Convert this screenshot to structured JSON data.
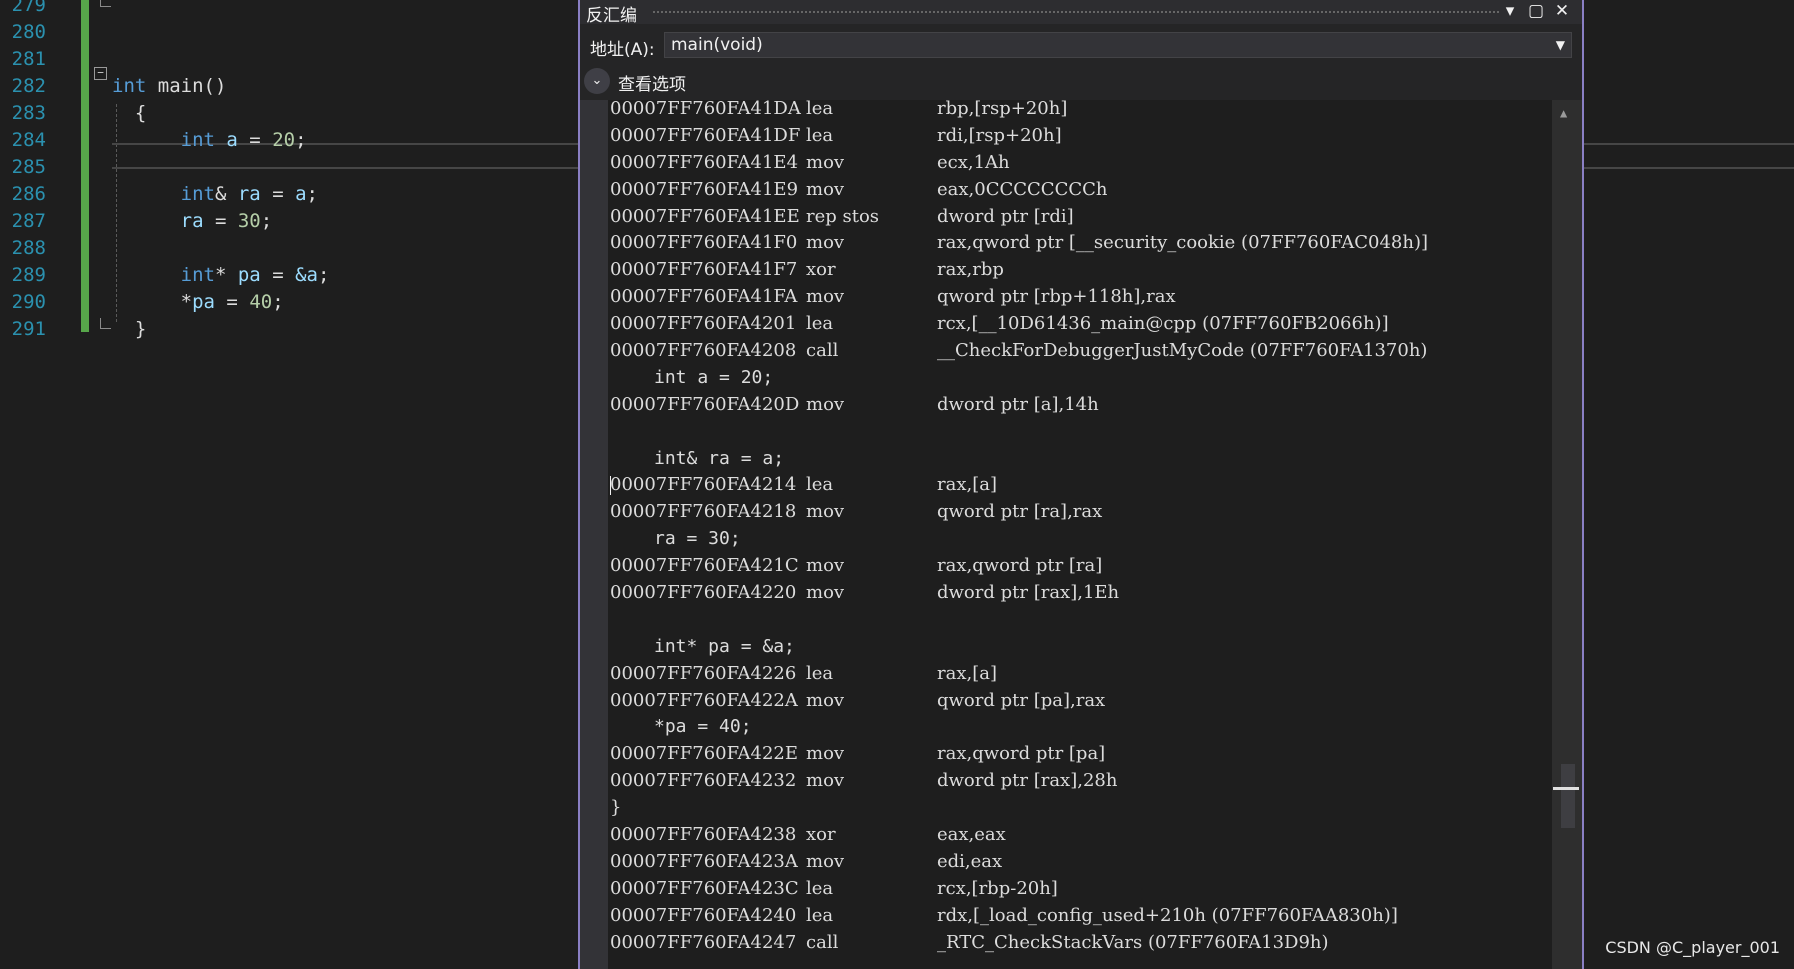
{
  "editor": {
    "line_numbers": [
      "279",
      "280",
      "281",
      "282",
      "283",
      "284",
      "285",
      "286",
      "287",
      "288",
      "289",
      "290",
      "291"
    ],
    "code": {
      "l282_kw": "int",
      "l282_rest": " main()",
      "l283": "{",
      "l284_kw": "int",
      "l284_var": " a",
      "l284_eq": " = ",
      "l284_num": "20",
      "l284_end": ";",
      "l286_kw": "int",
      "l286_rest": "& ",
      "l286_var": "ra",
      "l286_eq": " = ",
      "l286_var2": "a",
      "l286_end": ";",
      "l287_var": "ra",
      "l287_eq": " = ",
      "l287_num": "30",
      "l287_end": ";",
      "l289_kw": "int",
      "l289_rest": "* ",
      "l289_var": "pa",
      "l289_eq": " = ",
      "l289_var2": "&a",
      "l289_end": ";",
      "l290_star": "*",
      "l290_var": "pa",
      "l290_eq": " = ",
      "l290_num": "40",
      "l290_end": ";",
      "l291": "}"
    }
  },
  "disasm_window": {
    "title": "反汇编",
    "buttons": {
      "dropdown": "▾",
      "maximize": "▢",
      "close": "✕"
    },
    "address_label": "地址(A):",
    "address_value": "main(void)",
    "options_label": "查看选项",
    "rows": [
      {
        "addr": "00007FF760FA41DA",
        "mn": "lea",
        "op": "rbp,[rsp+20h]"
      },
      {
        "addr": "00007FF760FA41DF",
        "mn": "lea",
        "op": "rdi,[rsp+20h]"
      },
      {
        "addr": "00007FF760FA41E4",
        "mn": "mov",
        "op": "ecx,1Ah"
      },
      {
        "addr": "00007FF760FA41E9",
        "mn": "mov",
        "op": "eax,0CCCCCCCCh"
      },
      {
        "addr": "00007FF760FA41EE",
        "mn": "rep stos",
        "op": "dword ptr [rdi]"
      },
      {
        "addr": "00007FF760FA41F0",
        "mn": "mov",
        "op": "rax,qword ptr [__security_cookie (07FF760FAC048h)]"
      },
      {
        "addr": "00007FF760FA41F7",
        "mn": "xor",
        "op": "rax,rbp"
      },
      {
        "addr": "00007FF760FA41FA",
        "mn": "mov",
        "op": "qword ptr [rbp+118h],rax"
      },
      {
        "addr": "00007FF760FA4201",
        "mn": "lea",
        "op": "rcx,[__10D61436_main@cpp (07FF760FB2066h)]"
      },
      {
        "addr": "00007FF760FA4208",
        "mn": "call",
        "op": "__CheckForDebuggerJustMyCode (07FF760FA1370h)"
      },
      {
        "src": "int a = 20;"
      },
      {
        "addr": "00007FF760FA420D",
        "mn": "mov",
        "op": "dword ptr [a],14h"
      },
      {
        "src": ""
      },
      {
        "src": "int& ra = a;"
      },
      {
        "addr": "00007FF760FA4214",
        "mn": "lea",
        "op": "rax,[a]"
      },
      {
        "addr": "00007FF760FA4218",
        "mn": "mov",
        "op": "qword ptr [ra],rax"
      },
      {
        "src": "ra = 30;"
      },
      {
        "addr": "00007FF760FA421C",
        "mn": "mov",
        "op": "rax,qword ptr [ra]"
      },
      {
        "addr": "00007FF760FA4220",
        "mn": "mov",
        "op": "dword ptr [rax],1Eh"
      },
      {
        "src": ""
      },
      {
        "src": "int* pa = &a;"
      },
      {
        "addr": "00007FF760FA4226",
        "mn": "lea",
        "op": "rax,[a]"
      },
      {
        "addr": "00007FF760FA422A",
        "mn": "mov",
        "op": "qword ptr [pa],rax"
      },
      {
        "src": "*pa = 40;"
      },
      {
        "addr": "00007FF760FA422E",
        "mn": "mov",
        "op": "rax,qword ptr [pa]"
      },
      {
        "addr": "00007FF760FA4232",
        "mn": "mov",
        "op": "dword ptr [rax],28h"
      },
      {
        "brace": "}"
      },
      {
        "addr": "00007FF760FA4238",
        "mn": "xor",
        "op": "eax,eax"
      },
      {
        "addr": "00007FF760FA423A",
        "mn": "mov",
        "op": "edi,eax"
      },
      {
        "addr": "00007FF760FA423C",
        "mn": "lea",
        "op": "rcx,[rbp-20h]"
      },
      {
        "addr": "00007FF760FA4240",
        "mn": "lea",
        "op": "rdx,[_load_config_used+210h (07FF760FAA830h)]"
      },
      {
        "addr": "00007FF760FA4247",
        "mn": "call",
        "op": "_RTC_CheckStackVars (07FF760FA13D9h)"
      }
    ]
  },
  "watermark": "CSDN @C_player_001",
  "colors": {
    "background": "#1e1e1e",
    "line_number": "#2b91af",
    "keyword": "#569cd6",
    "number": "#b5cea8",
    "variable": "#9cdcfe",
    "change_bar": "#57a64a",
    "window_border": "#8a7fc4"
  }
}
